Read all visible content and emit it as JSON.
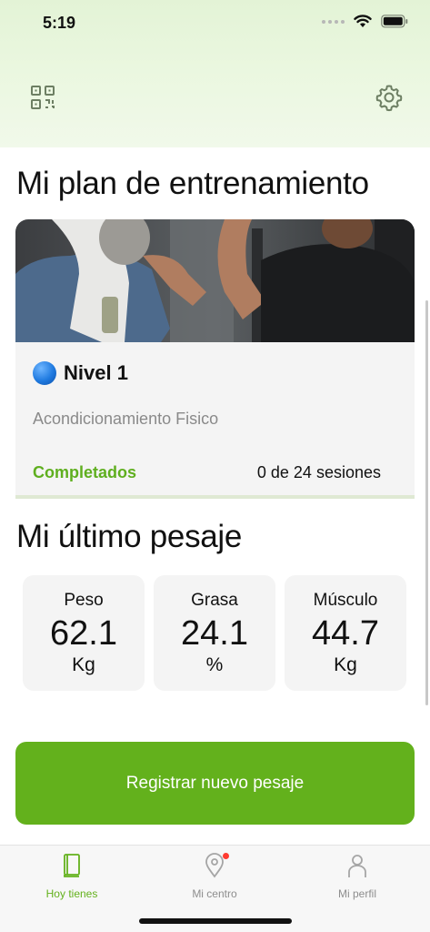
{
  "status_bar": {
    "time": "5:19"
  },
  "header": {
    "qr_icon": "qr-code-icon",
    "settings_icon": "gear-icon"
  },
  "plan": {
    "title": "Mi plan de entrenamiento",
    "level": "Nivel 1",
    "level_color": "#1f7ae0",
    "subtitle": "Acondicionamiento Fisico",
    "completed_label": "Completados",
    "sessions": "0 de 24 sesiones"
  },
  "weigh_in": {
    "title": "Mi último pesaje",
    "metrics": [
      {
        "label": "Peso",
        "value": "62.1",
        "unit": "Kg"
      },
      {
        "label": "Grasa",
        "value": "24.1",
        "unit": "%"
      },
      {
        "label": "Músculo",
        "value": "44.7",
        "unit": "Kg"
      }
    ]
  },
  "actions": {
    "register_label": "Registrar nuevo pesaje"
  },
  "tabs": [
    {
      "label": "Hoy tienes",
      "icon": "book-icon",
      "active": true
    },
    {
      "label": "Mi centro",
      "icon": "location-pin-icon",
      "active": false
    },
    {
      "label": "Mi perfil",
      "icon": "person-icon",
      "active": false
    }
  ],
  "colors": {
    "accent": "#63b11c",
    "header_bg": "#e6f5d9",
    "card_bg": "#f4f4f4"
  }
}
